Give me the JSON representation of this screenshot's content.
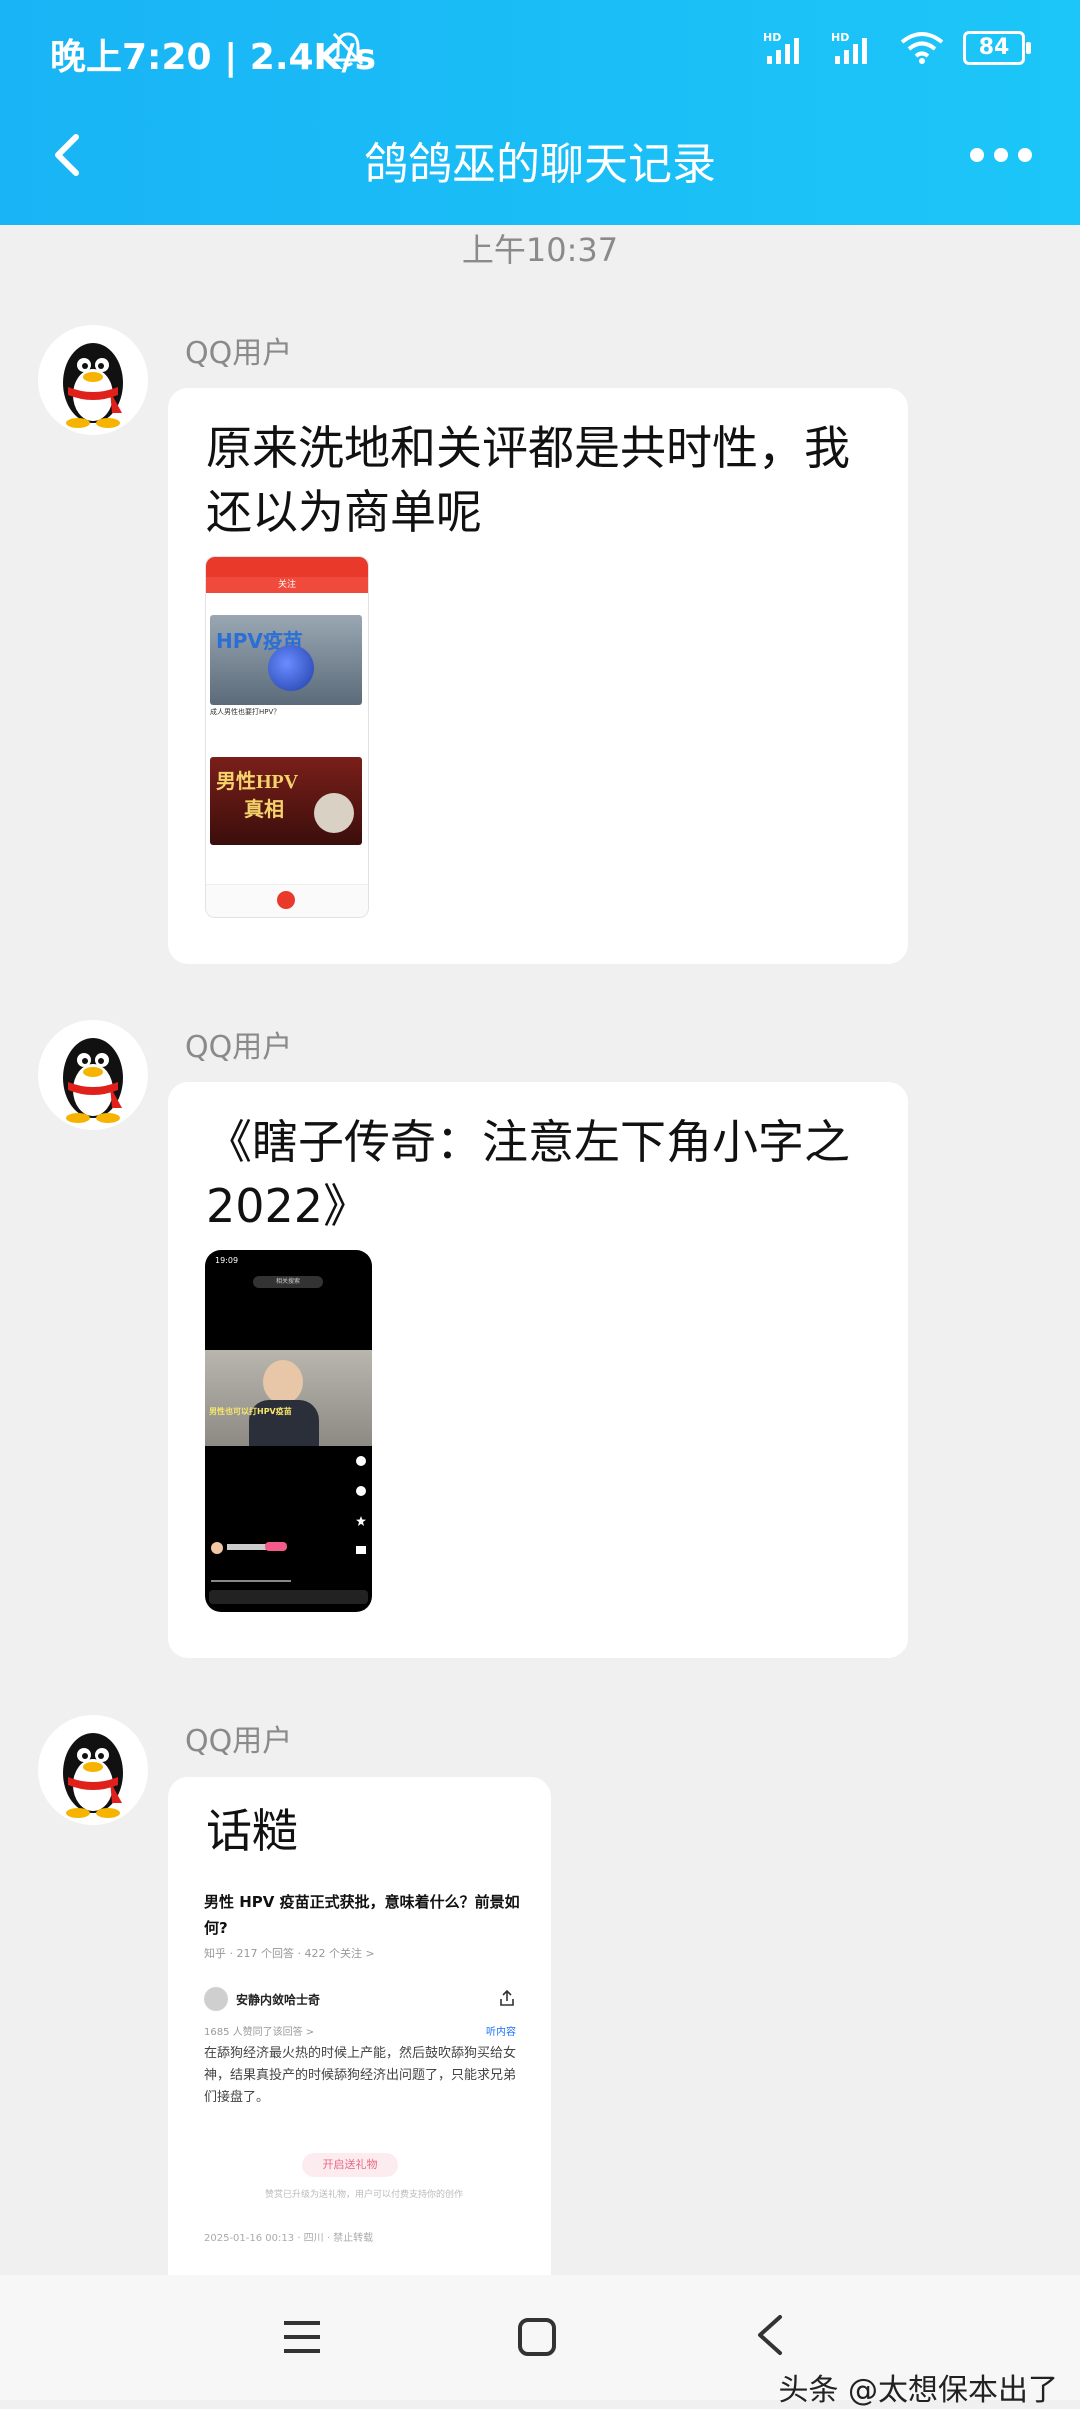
{
  "status_bar": {
    "time": "晚上7:20",
    "speed": "| 2.4K/s",
    "signal1": "HD",
    "signal2": "HD",
    "battery": "84"
  },
  "header": {
    "title": "鸽鸽巫的聊天记录",
    "accent_color": "#19b4f5"
  },
  "timestamp": "上午10:37",
  "messages": [
    {
      "sender": "QQ用户",
      "text_lines": [
        "原来洗地和关评都是共时性，我",
        "还以为商单呢"
      ],
      "screenshot": {
        "header_label": "关注",
        "card1_line": "成人男性也要打HPV？",
        "card1_title": "HPV疫苗",
        "card2_title": "男性HPV",
        "card2_subtitle": "真相"
      }
    },
    {
      "sender": "QQ用户",
      "text_lines": [
        "《瞎子传奇：注意左下角小字之",
        "2022》"
      ],
      "screenshot": {
        "time": "19:09",
        "topbar": "相关搜索",
        "caption": "男性也可以打HPV疫苗"
      }
    },
    {
      "sender": "QQ用户",
      "text_lines": [
        "话糙"
      ],
      "screenshot": {
        "title": "男性 HPV 疫苗正式获批，意味着什么？前景如何?",
        "meta": "知乎 · 217 个回答 · 422 个关注 >",
        "author": "安静内敛哈士奇",
        "likes": "1685 人赞同了该回答 >",
        "listen": "听内容",
        "body": "在舔狗经济最火热的时候上产能，然后鼓吹舔狗买给女神，结果真投产的时候舔狗经济出问题了，只能求兄弟们接盘了。",
        "gift_button": "开启送礼物",
        "gift_note": "赞赏已升级为送礼物，用户可以付费支持你的创作",
        "footer": "2025-01-16 00:13 · 四川 · 禁止转载"
      }
    }
  ],
  "watermark": "头条 @太想保本出了"
}
